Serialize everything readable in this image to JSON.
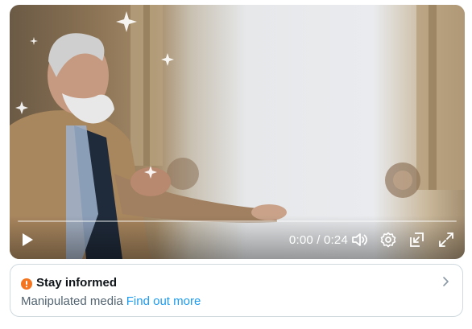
{
  "video": {
    "time_display": "0:00 / 0:24",
    "progress": 0
  },
  "icons": {
    "play": "play-icon",
    "volume": "volume-icon",
    "settings": "gear-icon",
    "pip": "picture-in-picture-icon",
    "fullscreen": "fullscreen-icon",
    "warning": "exclamation-circle-icon",
    "chevron": "chevron-right-icon"
  },
  "notice": {
    "title": "Stay informed",
    "description": "Manipulated media",
    "link_label": "Find out more"
  },
  "colors": {
    "warning": "#f4751f",
    "link": "#1d9bf0",
    "secondary_text": "#536471"
  }
}
